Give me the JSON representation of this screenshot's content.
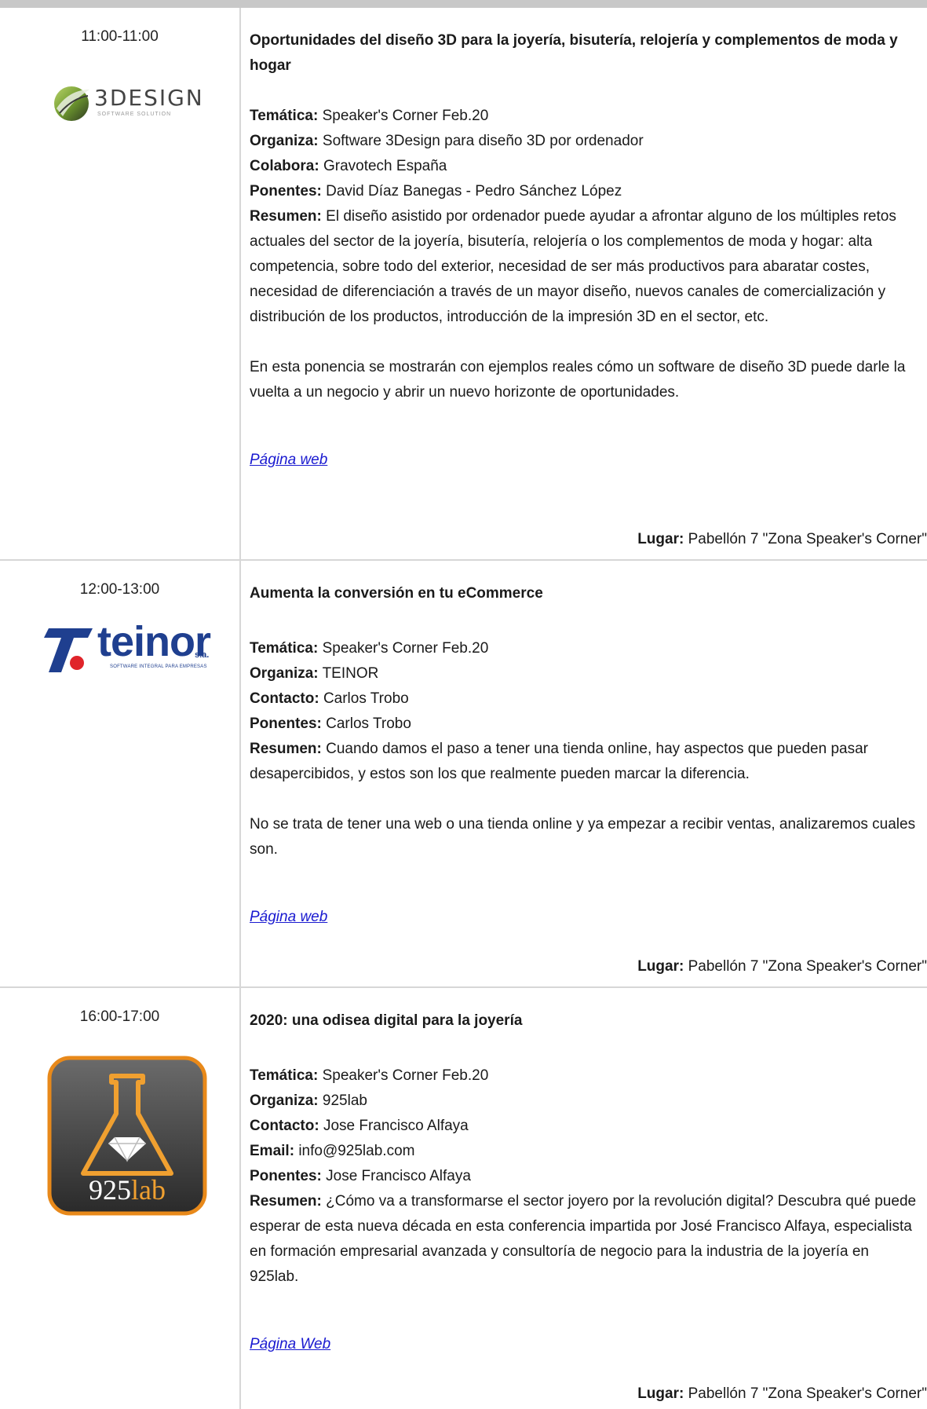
{
  "events": [
    {
      "time": "11:00-11:00",
      "logo_text": "3DESIGN",
      "logo_sub": "SOFTWARE SOLUTION",
      "title": "Oportunidades del diseño 3D para la joyería, bisutería, relojería y complementos de moda y hogar",
      "tematica_label": "Temática:",
      "tematica": "Speaker's Corner Feb.20",
      "organiza_label": "Organiza:",
      "organiza": "Software 3Design para diseño 3D por ordenador",
      "colabora_label": "Colabora:",
      "colabora": "Gravotech España",
      "ponentes_label": "Ponentes:",
      "ponentes": "David Díaz Banegas - Pedro Sánchez López",
      "resumen_label": "Resumen:",
      "resumen": "El diseño asistido por ordenador puede ayudar a afrontar alguno de los múltiples retos actuales del sector de la joyería, bisutería, relojería o los complementos de moda y hogar: alta competencia, sobre todo del exterior, necesidad de ser más productivos para abaratar costes, necesidad de diferenciación a través de un mayor diseño, nuevos canales de comercialización y distribución de los productos, introducción de la impresión 3D en el sector, etc.",
      "extra": "En esta ponencia se mostrarán con ejemplos reales cómo un software de diseño 3D puede darle la vuelta a un negocio y abrir un nuevo horizonte de oportunidades.",
      "link": "Página web",
      "lugar_label": "Lugar:",
      "lugar": "Pabellón 7 \"Zona Speaker's Corner\""
    },
    {
      "time": "12:00-13:00",
      "logo_text": "teinor",
      "logo_sa": "s.a.",
      "logo_sub": "SOFTWARE INTEGRAL PARA EMPRESAS",
      "title": "Aumenta la conversión en tu eCommerce",
      "tematica_label": "Temática:",
      "tematica": "Speaker's Corner Feb.20",
      "organiza_label": "Organiza:",
      "organiza": "TEINOR",
      "contacto_label": "Contacto:",
      "contacto": "Carlos Trobo",
      "ponentes_label": "Ponentes:",
      "ponentes": "Carlos Trobo",
      "resumen_label": "Resumen:",
      "resumen": "Cuando damos el paso a tener una tienda online, hay aspectos que pueden pasar desapercibidos, y estos son los que realmente pueden marcar la diferencia.",
      "extra": "No se trata de tener una web o una tienda online y ya empezar a recibir ventas, analizaremos cuales son.",
      "link": "Página web",
      "lugar_label": "Lugar:",
      "lugar": "Pabellón 7 \"Zona Speaker's Corner\""
    },
    {
      "time": "16:00-17:00",
      "logo_text_a": "925",
      "logo_text_b": "lab",
      "title": "2020: una odisea digital para la joyería",
      "tematica_label": "Temática:",
      "tematica": "Speaker's Corner Feb.20",
      "organiza_label": "Organiza:",
      "organiza": "925lab",
      "contacto_label": "Contacto:",
      "contacto": "Jose Francisco Alfaya",
      "email_label": "Email:",
      "email": "info@925lab.com",
      "ponentes_label": "Ponentes:",
      "ponentes": "Jose Francisco Alfaya",
      "resumen_label": "Resumen:",
      "resumen": "¿Cómo va a transformarse el sector joyero por la revolución digital? Descubra qué puede esperar de esta nueva década en esta conferencia impartida por José Francisco Alfaya, especialista en formación empresarial avanzada y consultoría de negocio para la industria de la joyería en 925lab.",
      "link": "Página Web",
      "lugar_label": "Lugar:",
      "lugar": "Pabellón 7 \"Zona Speaker's Corner\""
    }
  ]
}
